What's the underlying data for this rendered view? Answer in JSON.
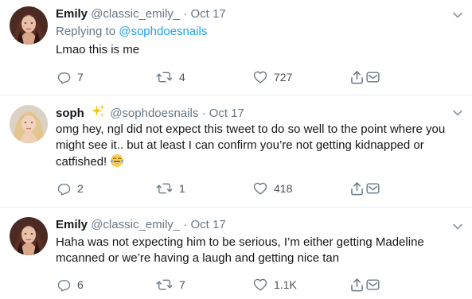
{
  "tweets": [
    {
      "name": "Emily",
      "handle": "@classic_emily_",
      "separator": "·",
      "time": "Oct 17",
      "replying_label": "Replying to",
      "replying_to": "@sophdoesnails",
      "text": "Lmao this is me",
      "reply_count": "7",
      "retweet_count": "4",
      "like_count": "727"
    },
    {
      "name": "soph",
      "handle": "@sophdoesnails",
      "separator": "·",
      "time": "Oct 17",
      "text_line1": "omg hey, ngl did not expect this tweet to do so well to the point where you",
      "text_line2": "might see it.. but at least I can confirm you’re not getting kidnapped or",
      "text_line3": "catfished!",
      "reply_count": "2",
      "retweet_count": "1",
      "like_count": "418"
    },
    {
      "name": "Emily",
      "handle": "@classic_emily_",
      "separator": "·",
      "time": "Oct 17",
      "text_line1": "Haha was not expecting him to be serious, I’m either getting Madeline",
      "text_line2": "mcanned or we’re having a laugh and getting nice tan",
      "reply_count": "6",
      "retweet_count": "7",
      "like_count": "1.1K"
    }
  ],
  "colors": {
    "link": "#1da1f2",
    "meta": "#657786",
    "text": "#14171a",
    "divider": "#e6ecf0",
    "sparkle": "#f5c518"
  },
  "icons": [
    "reply-icon",
    "retweet-icon",
    "like-icon",
    "share-icon",
    "dm-icon",
    "caret-down-icon",
    "sparkle-icon",
    "laughing-tears-emoji"
  ]
}
